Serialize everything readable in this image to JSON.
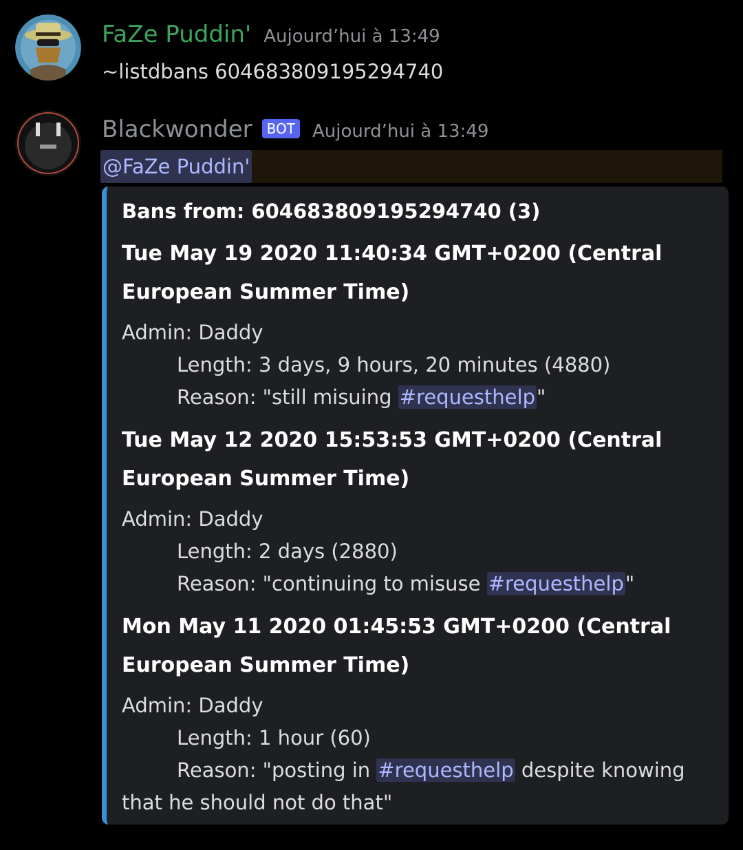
{
  "colors": {
    "background": "#000000",
    "user1_name": "#3ba55c",
    "bot_name": "#8e9297",
    "bot_tag": "#5865f2",
    "mention": "#aeb8ff",
    "embed_border": "#3692d8"
  },
  "messages": [
    {
      "author": "FaZe Puddin'",
      "timestamp": "Aujourd’hui à 13:49",
      "text": "~listdbans 604683809195294740"
    },
    {
      "author": "Blackwonder",
      "bot_tag": "BOT",
      "timestamp": "Aujourd’hui à 13:49",
      "mention": "@FaZe Puddin'",
      "embed": {
        "title": "Bans from: 604683809195294740 (3)",
        "fields": [
          {
            "name_line1": "Tue May 19 2020 11:40:34 GMT+0200 (Central",
            "name_line2": "European Summer Time)",
            "admin": "Admin: Daddy",
            "length": "Length: 3 days, 9 hours, 20 minutes (4880)",
            "reason_prefix": "Reason: \"still misuing ",
            "channel": "#requesthelp",
            "reason_suffix": "\""
          },
          {
            "name_line1": "Tue May 12 2020 15:53:53 GMT+0200 (Central",
            "name_line2": "European Summer Time)",
            "admin": "Admin: Daddy",
            "length": "Length: 2 days (2880)",
            "reason_prefix": "Reason: \"continuing to misuse ",
            "channel": "#requesthelp",
            "reason_suffix": "\""
          },
          {
            "name_line1": "Mon May 11 2020 01:45:53 GMT+0200 (Central",
            "name_line2": "European Summer Time)",
            "admin": "Admin: Daddy",
            "length": "Length: 1 hour (60)",
            "reason_prefix": "Reason: \"posting in ",
            "channel": "#requesthelp",
            "reason_suffix": " despite knowing",
            "reason_line2": "that he should not do that\""
          }
        ]
      }
    }
  ]
}
